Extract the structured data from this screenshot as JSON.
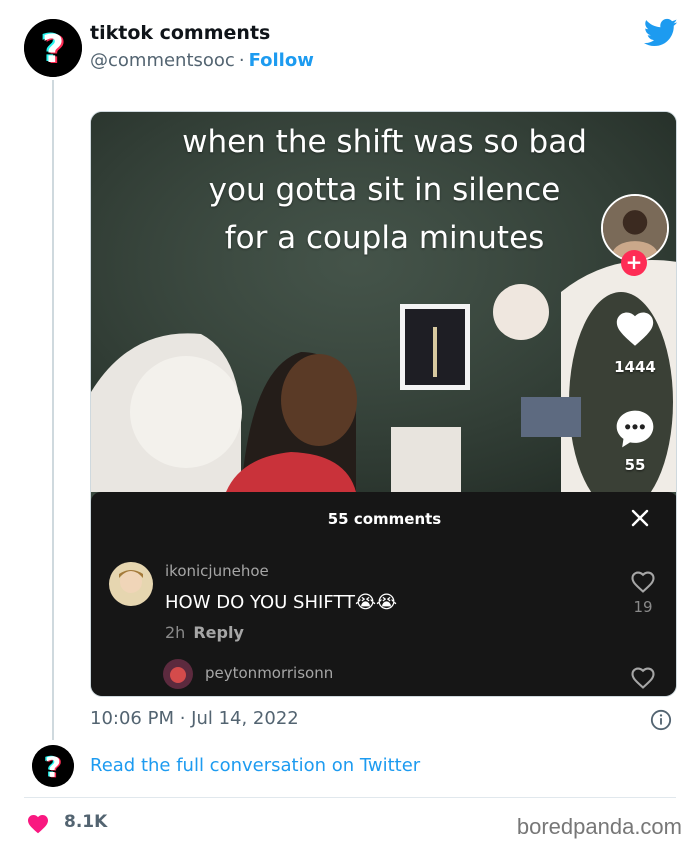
{
  "author": {
    "display_name": "tiktok comments",
    "handle": "@commentsooc",
    "separator": "·",
    "follow_label": "Follow",
    "avatar_icon": "tiktok-question-mark-icon"
  },
  "brand_icon": "twitter-bird-icon",
  "media": {
    "caption_lines": [
      "when the shift was so bad",
      "you gotta sit in silence",
      "for a coupla minutes"
    ],
    "side_like_count": "1444",
    "side_comment_count": "55",
    "plus_glyph": "+",
    "comments_sheet": {
      "title": "55 comments",
      "close_glyph": "✕",
      "comments": [
        {
          "username": "ikonicjunehoe",
          "text": "HOW DO YOU SHIFTT😭😭",
          "time": "2h",
          "reply_label": "Reply",
          "likes": "19"
        },
        {
          "username": "peytonmorrisonn",
          "text": "",
          "time": "",
          "reply_label": "",
          "likes": ""
        }
      ]
    }
  },
  "timestamp": "10:06 PM · Jul 14, 2022",
  "read_conversation_label": "Read the full conversation on Twitter",
  "likes": "8.1K",
  "watermark": "boredpanda.com",
  "colors": {
    "twitter_blue": "#1d9bf0",
    "like_red": "#f91880",
    "tiktok_pink": "#fe2c55",
    "sheet_bg": "#161616"
  }
}
